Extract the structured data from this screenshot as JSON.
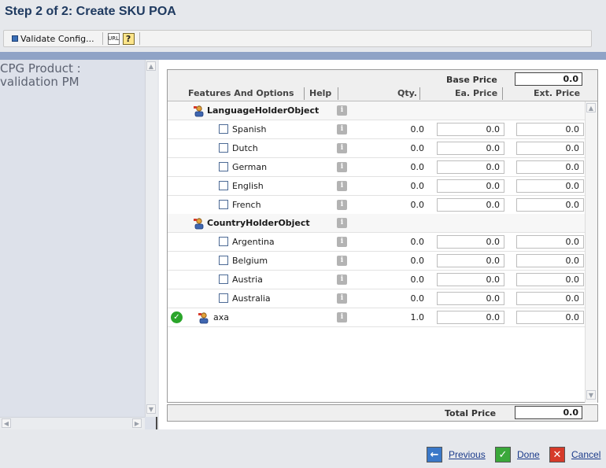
{
  "page": {
    "title": "Step 2 of 2: Create SKU POA"
  },
  "toolbar": {
    "validate_label": "Validate Config...",
    "url_icon_text": "URL",
    "help_icon_text": "?"
  },
  "left_panel": {
    "title_line1": "CPG Product :",
    "title_line2": "validation PM"
  },
  "grid": {
    "base_price_label": "Base Price",
    "base_price_value": "0.0",
    "columns": {
      "features": "Features And Options",
      "help": "Help",
      "qty": "Qty.",
      "ea_price": "Ea. Price",
      "ext_price": "Ext. Price"
    },
    "info_glyph": "i",
    "rows": [
      {
        "kind": "group",
        "label": "LanguageHolderObject"
      },
      {
        "kind": "option",
        "label": "Spanish",
        "qty": "0.0",
        "ea": "0.0",
        "ext": "0.0",
        "checked": false
      },
      {
        "kind": "option",
        "label": "Dutch",
        "qty": "0.0",
        "ea": "0.0",
        "ext": "0.0",
        "checked": false
      },
      {
        "kind": "option",
        "label": "German",
        "qty": "0.0",
        "ea": "0.0",
        "ext": "0.0",
        "checked": false
      },
      {
        "kind": "option",
        "label": "English",
        "qty": "0.0",
        "ea": "0.0",
        "ext": "0.0",
        "checked": false
      },
      {
        "kind": "option",
        "label": "French",
        "qty": "0.0",
        "ea": "0.0",
        "ext": "0.0",
        "checked": false
      },
      {
        "kind": "group",
        "label": "CountryHolderObject"
      },
      {
        "kind": "option",
        "label": "Argentina",
        "qty": "0.0",
        "ea": "0.0",
        "ext": "0.0",
        "checked": false
      },
      {
        "kind": "option",
        "label": "Belgium",
        "qty": "0.0",
        "ea": "0.0",
        "ext": "0.0",
        "checked": false
      },
      {
        "kind": "option",
        "label": "Austria",
        "qty": "0.0",
        "ea": "0.0",
        "ext": "0.0",
        "checked": false
      },
      {
        "kind": "option",
        "label": "Australia",
        "qty": "0.0",
        "ea": "0.0",
        "ext": "0.0",
        "checked": false
      },
      {
        "kind": "item",
        "label": "axa",
        "qty": "1.0",
        "ea": "0.0",
        "ext": "0.0",
        "valid": true
      }
    ],
    "total_price_label": "Total Price",
    "total_price_value": "0.0"
  },
  "footer": {
    "previous_label": "Previous",
    "done_label": "Done",
    "cancel_label": "Cancel"
  },
  "colors": {
    "accent_band": "#8fa3c6",
    "title_color": "#1f3a60",
    "valid_green": "#2aa52a"
  }
}
